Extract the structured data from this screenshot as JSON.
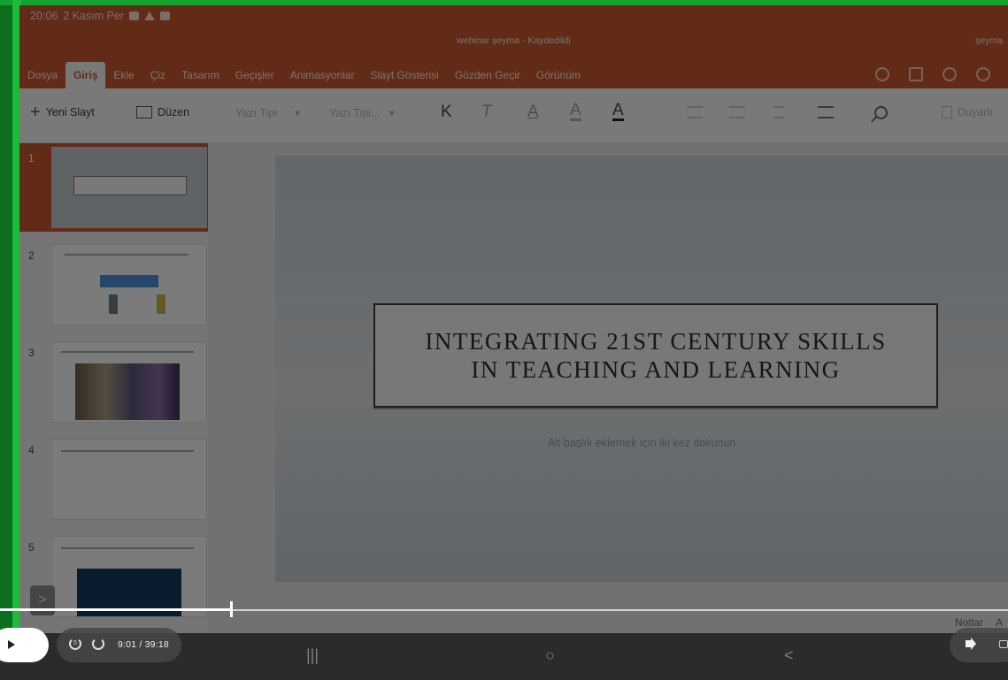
{
  "status_bar": {
    "time": "20:06",
    "date": "2 Kasım Per"
  },
  "header": {
    "doc_title": "webinar şeyma - Kaydedildi",
    "user": "şeyma"
  },
  "tabs": [
    {
      "label": "Dosya"
    },
    {
      "label": "Giriş",
      "active": true
    },
    {
      "label": "Ekle"
    },
    {
      "label": "Çiz"
    },
    {
      "label": "Tasarım"
    },
    {
      "label": "Geçişler"
    },
    {
      "label": "Animasyonlar"
    },
    {
      "label": "Slayt Gösterisi"
    },
    {
      "label": "Gözden Geçir"
    },
    {
      "label": "Görünüm"
    }
  ],
  "toolbar": {
    "new_slide": "Yeni Slayt",
    "layout": "Düzen",
    "font_name_placeholder": "Yazı Tipi",
    "font_size_placeholder": "Yazı Tipi...",
    "bold": "K",
    "italic": "T",
    "underline": "A",
    "highlight": "A",
    "font_color": "A",
    "dictate": "Duyarlı"
  },
  "slides_panel": {
    "items": [
      {
        "number": "1",
        "selected": true
      },
      {
        "number": "2"
      },
      {
        "number": "3"
      },
      {
        "number": "4"
      },
      {
        "number": "5"
      }
    ],
    "toggle_icon": ">"
  },
  "slide": {
    "title_line1": "INTEGRATING 21ST CENTURY SKILLS",
    "title_line2": "IN TEACHING AND LEARNING",
    "subtitle_placeholder": "Alt başlık eklemek için iki kez dokunun"
  },
  "bottom_bar": {
    "notes": "Notlar",
    "comments": "A"
  },
  "video_player": {
    "current_time": "9:01",
    "separator": "/",
    "duration": "39:18",
    "progress": 0.2294,
    "seek_back": "5",
    "seek_forward": "5"
  },
  "android_nav": {
    "recents": "|||",
    "home": "○",
    "back": "<"
  }
}
